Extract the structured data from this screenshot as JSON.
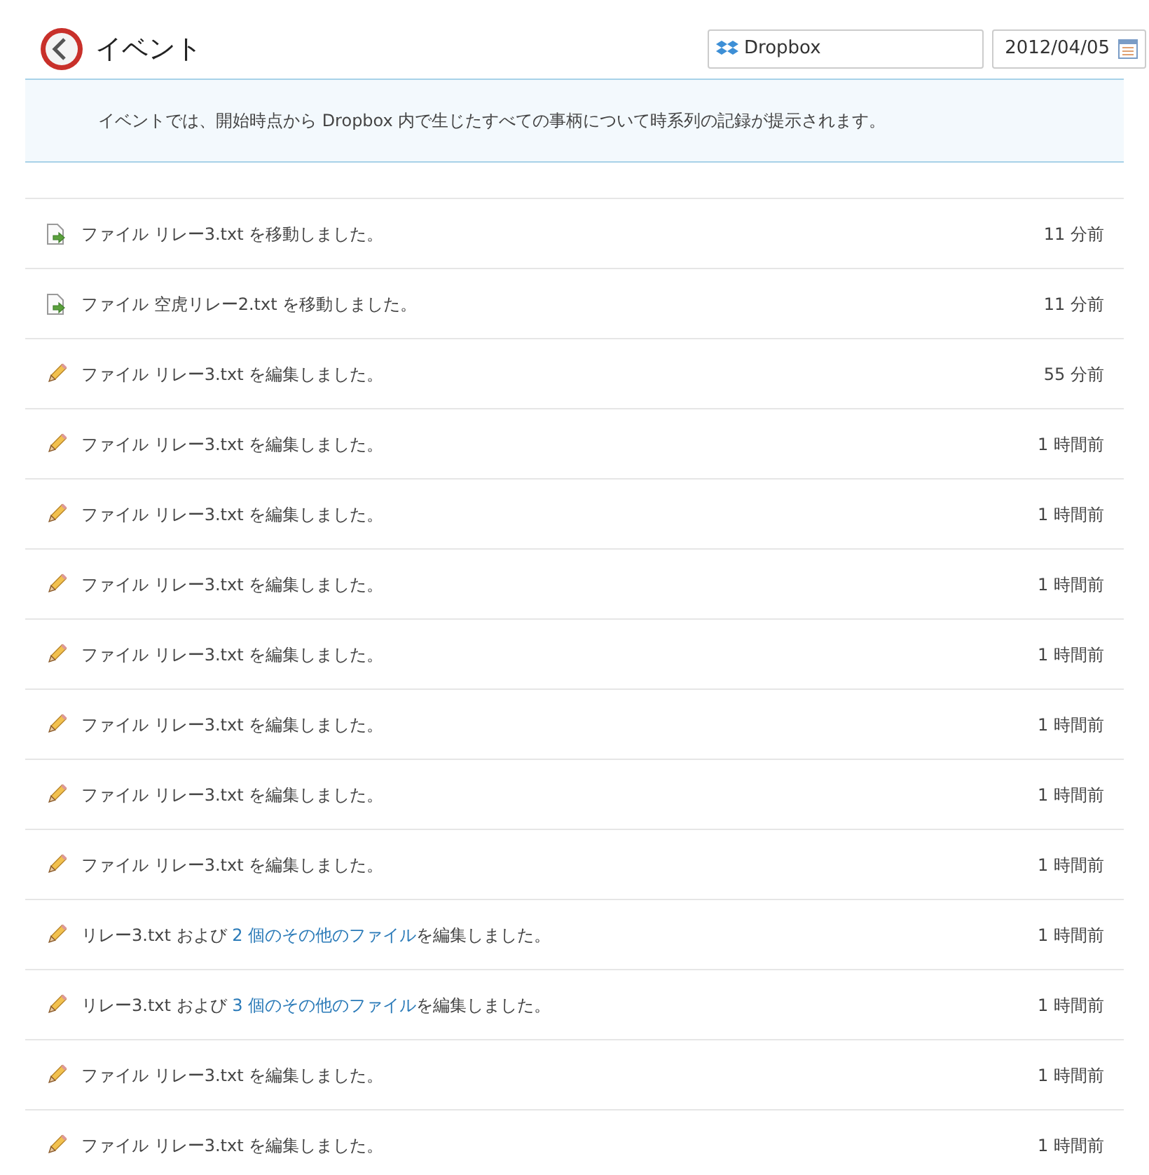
{
  "header": {
    "title": "イベント",
    "folder": "Dropbox",
    "date": "2012/04/05"
  },
  "info": "イベントでは、開始時点から Dropbox 内で生じたすべての事柄について時系列の記録が提示されます。",
  "events": [
    {
      "kind": "move",
      "text": "ファイル リレー3.txt を移動しました。",
      "time": "11 分前"
    },
    {
      "kind": "move",
      "text": "ファイル 空虎リレー2.txt を移動しました。",
      "time": "11 分前"
    },
    {
      "kind": "edit",
      "text": "ファイル リレー3.txt を編集しました。",
      "time": "55 分前"
    },
    {
      "kind": "edit",
      "text": "ファイル リレー3.txt を編集しました。",
      "time": "1 時間前"
    },
    {
      "kind": "edit",
      "text": "ファイル リレー3.txt を編集しました。",
      "time": "1 時間前"
    },
    {
      "kind": "edit",
      "text": "ファイル リレー3.txt を編集しました。",
      "time": "1 時間前"
    },
    {
      "kind": "edit",
      "text": "ファイル リレー3.txt を編集しました。",
      "time": "1 時間前"
    },
    {
      "kind": "edit",
      "text": "ファイル リレー3.txt を編集しました。",
      "time": "1 時間前"
    },
    {
      "kind": "edit",
      "text": "ファイル リレー3.txt を編集しました。",
      "time": "1 時間前"
    },
    {
      "kind": "edit",
      "text": "ファイル リレー3.txt を編集しました。",
      "time": "1 時間前"
    },
    {
      "kind": "edit",
      "text": "リレー3.txt および ",
      "link": "2 個のその他のファイル",
      "suffix": "を編集しました。",
      "time": "1 時間前"
    },
    {
      "kind": "edit",
      "text": "リレー3.txt および ",
      "link": "3 個のその他のファイル",
      "suffix": "を編集しました。",
      "time": "1 時間前"
    },
    {
      "kind": "edit",
      "text": "ファイル リレー3.txt を編集しました。",
      "time": "1 時間前"
    },
    {
      "kind": "edit",
      "text": "ファイル リレー3.txt を編集しました。",
      "time": "1 時間前"
    }
  ]
}
